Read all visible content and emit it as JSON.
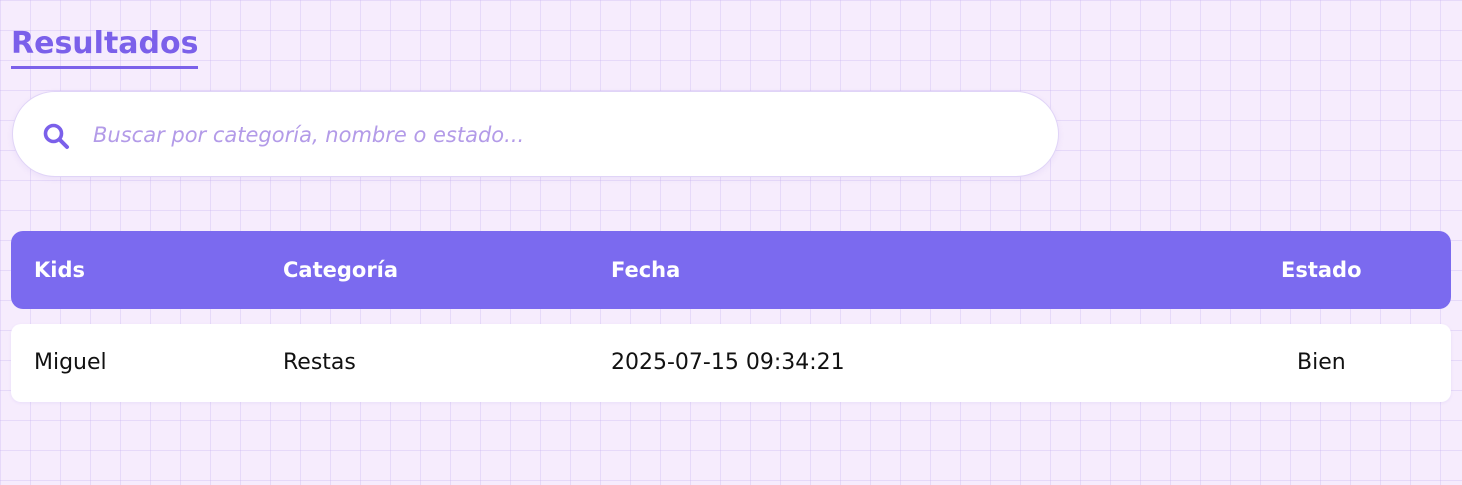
{
  "page": {
    "title": "Resultados"
  },
  "search": {
    "placeholder": "Buscar por categoría, nombre o estado...",
    "value": "",
    "icon": "search-icon"
  },
  "table": {
    "headers": {
      "kids": "Kids",
      "categoria": "Categoría",
      "fecha": "Fecha",
      "estado": "Estado"
    },
    "rows": [
      {
        "kids": "Miguel",
        "categoria": "Restas",
        "fecha": "2025-07-15 09:34:21",
        "estado": "Bien"
      }
    ]
  },
  "colors": {
    "accent": "#7b60ea",
    "header_bg": "#7b6aef",
    "background": "#f6ecfd",
    "placeholder": "#b39be8"
  }
}
